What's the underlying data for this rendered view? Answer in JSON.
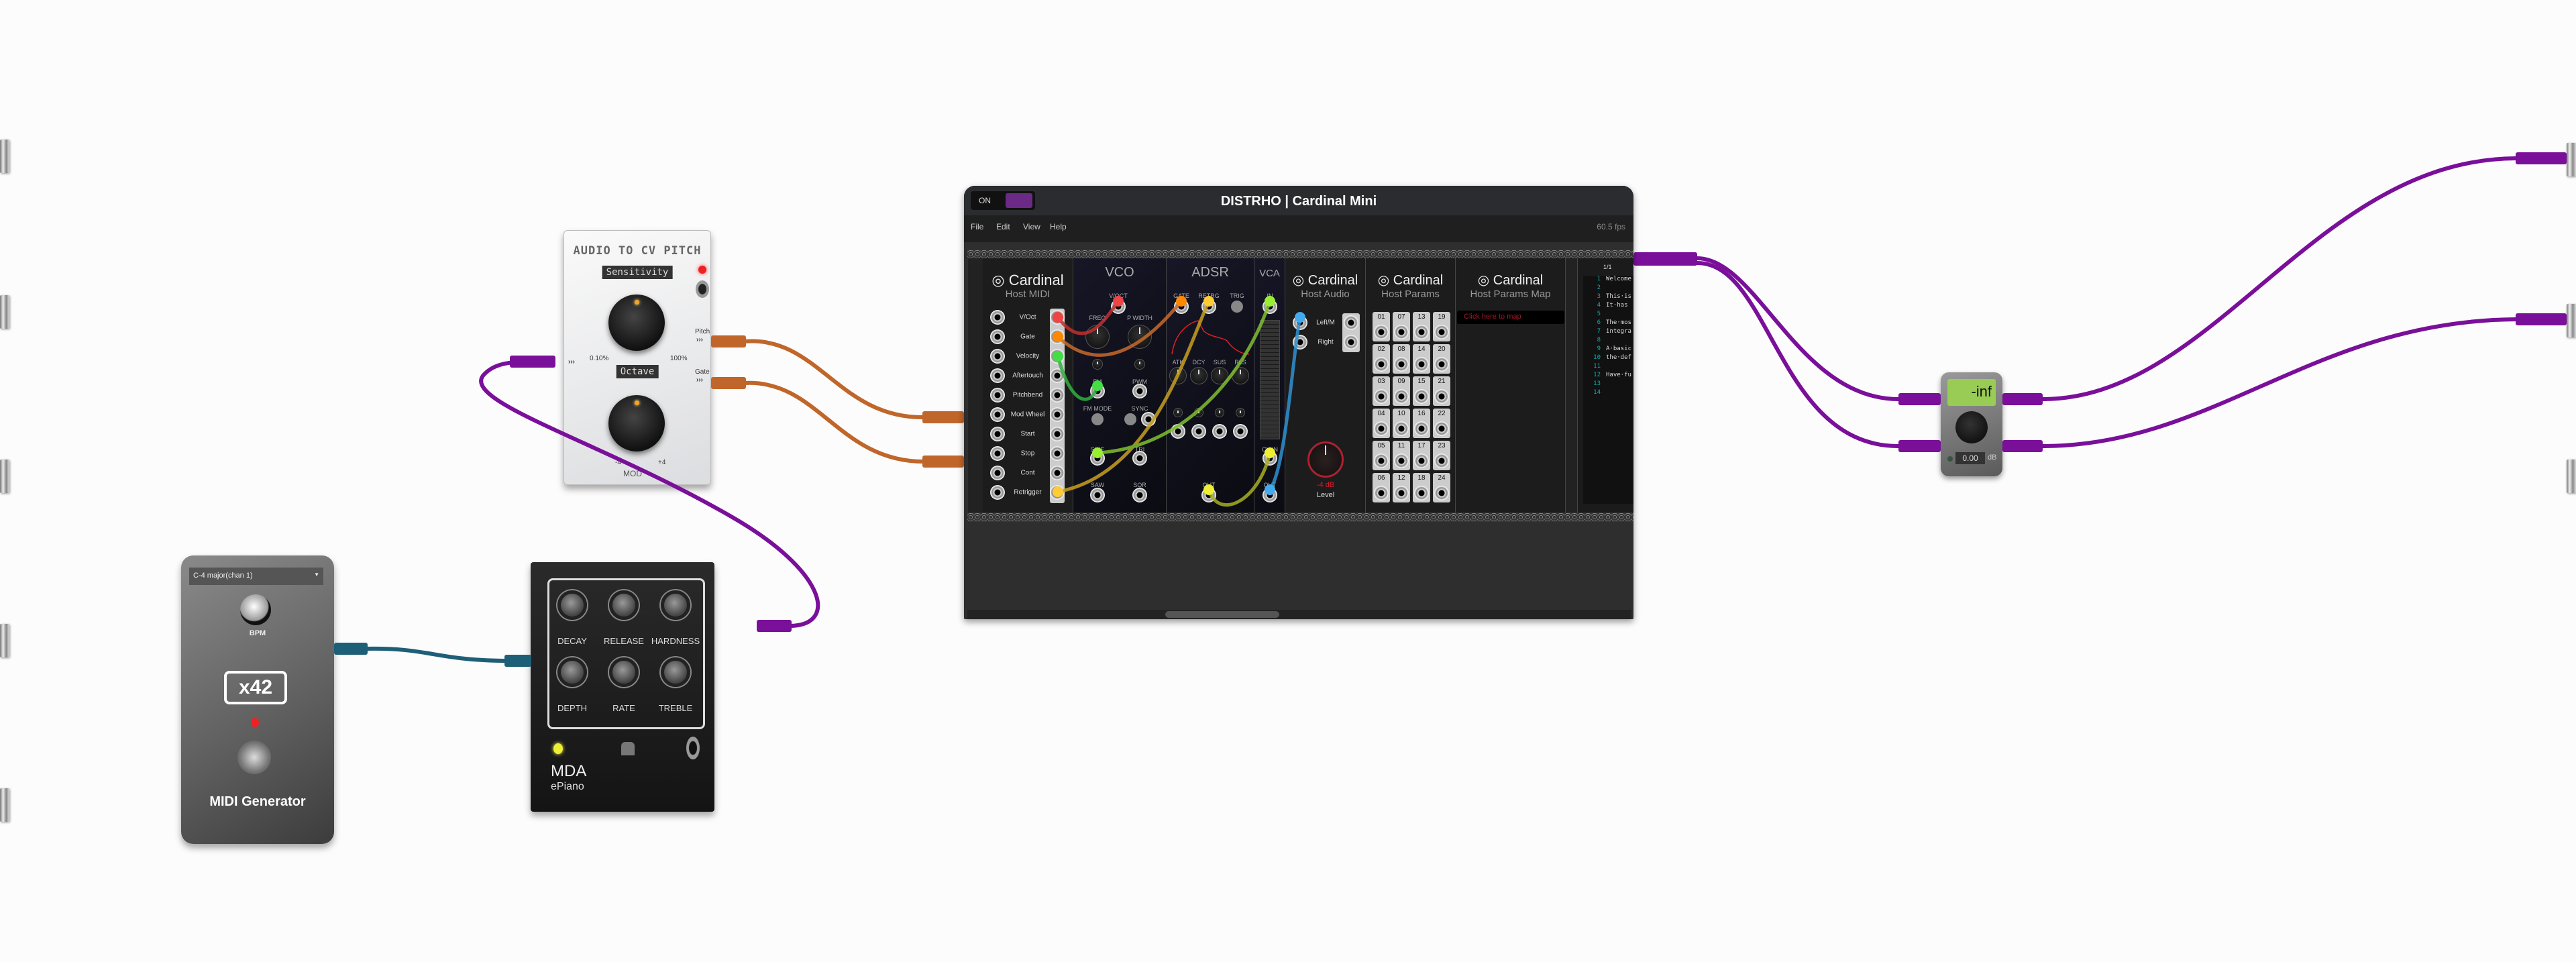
{
  "cardinal": {
    "title": "DISTRHO | Cardinal Mini",
    "on_label": "ON",
    "menu": [
      "File",
      "Edit",
      "View",
      "Help"
    ],
    "fps": "60.5 fps",
    "brand": "Cardinal",
    "host_midi": {
      "subtitle": "Host MIDI",
      "rows": [
        "V/Oct",
        "Gate",
        "Velocity",
        "Aftertouch",
        "Pitchbend",
        "Mod Wheel",
        "Start",
        "Stop",
        "Cont",
        "Retrigger"
      ]
    },
    "vco": {
      "title": "VCO",
      "voct": "V/OCT",
      "freq": "FREQ",
      "pwidth": "P WIDTH",
      "fm": "FM",
      "pwm": "PWM",
      "fm_mode": "FM MODE",
      "sync": "SYNC",
      "sine": "SINE",
      "tri": "TRI",
      "saw": "SAW",
      "sqr": "SQR",
      "minus": "-",
      "plus": "+"
    },
    "adsr": {
      "title": "ADSR",
      "gate": "GATE",
      "retrg": "RETRG",
      "trig": "TRIG",
      "atk": "ATK",
      "dcy": "DCY",
      "sus": "SUS",
      "rls": "RLS",
      "out": "OUT"
    },
    "vca": {
      "title": "VCA",
      "in": "IN",
      "cv_in": "CV IN",
      "out": "OUT"
    },
    "host_audio": {
      "subtitle": "Host Audio",
      "left": "Left/M",
      "right": "Right",
      "level_value": "-4 dB",
      "level_label": "Level"
    },
    "host_params": {
      "subtitle": "Host Params",
      "cells": [
        "01",
        "07",
        "13",
        "19",
        "02",
        "08",
        "14",
        "20",
        "03",
        "09",
        "15",
        "21",
        "04",
        "10",
        "16",
        "22",
        "05",
        "11",
        "17",
        "23",
        "06",
        "12",
        "18",
        "24"
      ]
    },
    "params_map": {
      "subtitle": "Host Params Map",
      "map_button": "Click here to map"
    },
    "notes": {
      "page": "1/1",
      "lines": [
        [
          "1",
          "Welcome"
        ],
        [
          "2",
          ""
        ],
        [
          "3",
          "This·is"
        ],
        [
          "4",
          "It·has"
        ],
        [
          "5",
          ""
        ],
        [
          "6",
          "The·mos"
        ],
        [
          "7",
          "integra"
        ],
        [
          "8",
          ""
        ],
        [
          "9",
          "A·basic"
        ],
        [
          "10",
          "the·def"
        ],
        [
          "11",
          ""
        ],
        [
          "12",
          "Have·fu"
        ],
        [
          "13",
          ""
        ],
        [
          "14",
          ""
        ]
      ]
    }
  },
  "audio_to_cv": {
    "title": "AUDIO TO CV PITCH",
    "sensitivity": "Sensitivity",
    "sens_min": "0.10%",
    "sens_max": "100%",
    "octave": "Octave",
    "oct_min": "-4",
    "oct_max": "+4",
    "pitch_out": "Pitch",
    "gate_out": "Gate",
    "arrows": "›››",
    "brand": "MOD"
  },
  "midi_gen": {
    "preset": "C-4 major(chan 1)",
    "bpm": "BPM",
    "multiplier": "x42",
    "name": "MIDI Generator"
  },
  "epiano": {
    "knobs": [
      "DECAY",
      "RELEASE",
      "HARDNESS",
      "DEPTH",
      "RATE",
      "TREBLE"
    ],
    "brand": "MDA",
    "name": "ePiano"
  },
  "gain": {
    "meter": "-inf",
    "value": "0.00",
    "unit": "dB"
  },
  "colors": {
    "purple_cable": "#7a0f9a",
    "orange_cable": "#c0662a",
    "teal_cable": "#1e5f78",
    "accent": "#8b2fa8"
  }
}
